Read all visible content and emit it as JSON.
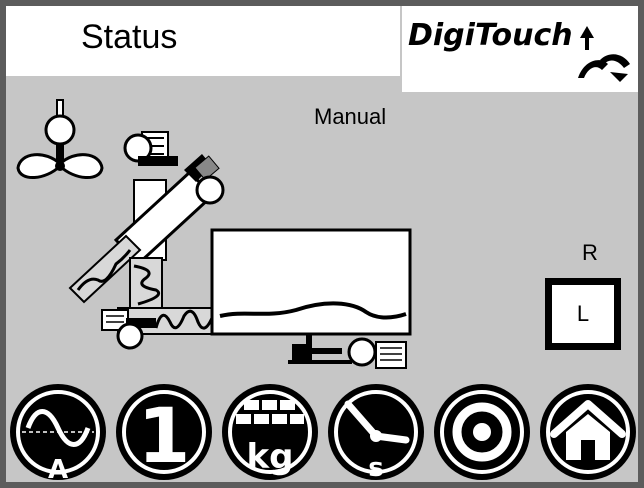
{
  "header": {
    "title": "Status",
    "brand": "DigiTouch"
  },
  "status": {
    "mode": "Manual",
    "right_label": "R",
    "left_button_label": "L"
  },
  "toolbar": {
    "buttons": [
      {
        "name": "current",
        "icon": "sine-wave-ampere-icon",
        "label": "A"
      },
      {
        "name": "program-1",
        "icon": "number-one-icon",
        "label": "1"
      },
      {
        "name": "weight",
        "icon": "bricks-kg-icon",
        "label": "kg"
      },
      {
        "name": "time",
        "icon": "clock-seconds-icon",
        "label": "s"
      },
      {
        "name": "record",
        "icon": "target-circle-icon",
        "label": ""
      },
      {
        "name": "home",
        "icon": "home-icon",
        "label": ""
      }
    ]
  },
  "colors": {
    "background": "#c6c6c6",
    "frame": "#5c5c5c",
    "panel": "#ffffff",
    "ink": "#000000"
  }
}
